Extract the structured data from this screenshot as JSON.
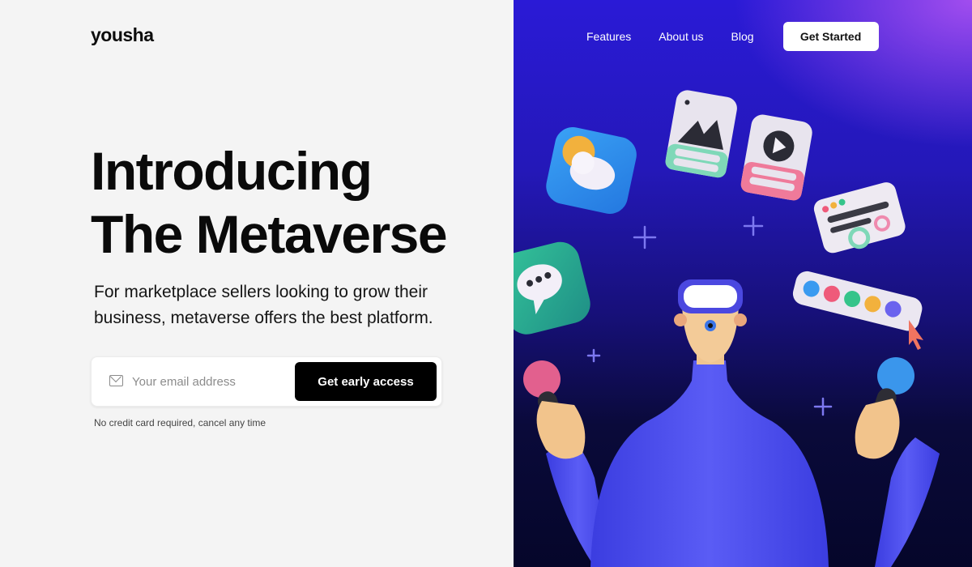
{
  "brand": {
    "logo": "yousha"
  },
  "nav": {
    "links": [
      "Features",
      "About us",
      "Blog"
    ],
    "cta": "Get Started"
  },
  "hero": {
    "headline_line1": "Introducing",
    "headline_line2": "The Metaverse",
    "subtitle": "For marketplace sellers looking to grow their business, metaverse offers the best platform.",
    "email_placeholder": "Your email address",
    "email_value": "",
    "submit_label": "Get early access",
    "note": "No credit card required, cancel any time"
  },
  "illustration": {
    "description": "3D character wearing VR headset holding controllers, surrounded by floating app icons",
    "icons": [
      "weather-app-icon",
      "image-card-icon",
      "video-card-icon",
      "chat-app-icon",
      "ui-card-icon",
      "color-palette-icon"
    ],
    "colors": {
      "panel_top": "#2a1ad6",
      "panel_accent": "#a850f0",
      "panel_bottom": "#05062a",
      "sweater": "#4b4df0",
      "plus": "#7d78f0"
    }
  }
}
